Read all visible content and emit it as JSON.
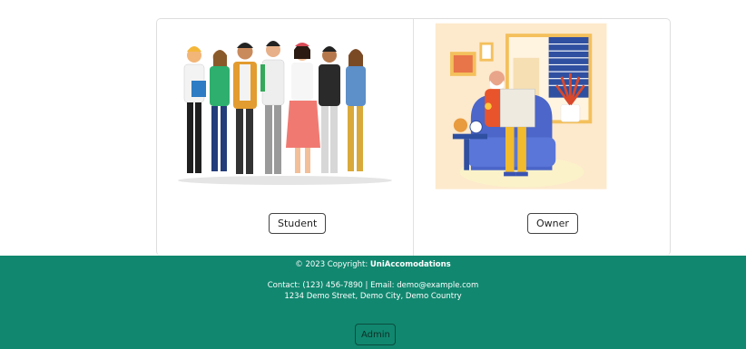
{
  "cards": [
    {
      "illustration": "group-of-students-illustration",
      "button_label": "Student"
    },
    {
      "illustration": "old-man-reading-newspaper-illustration",
      "button_label": "Owner"
    }
  ],
  "footer": {
    "copyright_prefix": "© 2023 Copyright:",
    "brand": "UniAccomodations",
    "contact_line": "Contact: (123) 456-7890 | Email: demo@example.com",
    "address_line": "1234 Demo Street, Demo City, Demo Country",
    "admin_label": "Admin"
  },
  "colors": {
    "footer_bg": "#11876f",
    "card_border": "#dedede"
  }
}
